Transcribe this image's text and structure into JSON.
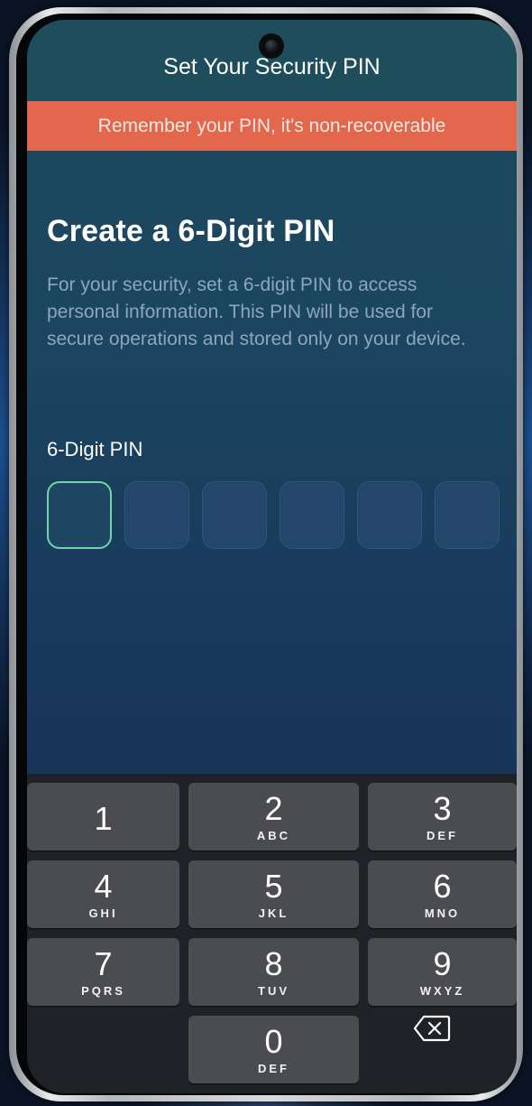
{
  "header": {
    "title": "Set Your Security PIN"
  },
  "banner": {
    "text": "Remember your PIN, it's non-recoverable",
    "color": "#e2674d"
  },
  "main": {
    "heading": "Create a 6-Digit PIN",
    "description": "For your security, set a 6-digit PIN to access personal information. This PIN will be used for secure operations and stored only on your device.",
    "pin_label": "6-Digit PIN",
    "pin_length": 6,
    "pin_entered": 0,
    "active_color": "#6fd4ac"
  },
  "keypad": {
    "keys": [
      {
        "digit": "1",
        "letters": ""
      },
      {
        "digit": "2",
        "letters": "ABC"
      },
      {
        "digit": "3",
        "letters": "DEF"
      },
      {
        "digit": "4",
        "letters": "GHI"
      },
      {
        "digit": "5",
        "letters": "JKL"
      },
      {
        "digit": "6",
        "letters": "MNO"
      },
      {
        "digit": "7",
        "letters": "PQRS"
      },
      {
        "digit": "8",
        "letters": "TUV"
      },
      {
        "digit": "9",
        "letters": "WXYZ"
      },
      {
        "digit": "0",
        "letters": "DEF"
      }
    ],
    "backspace_icon": "backspace-icon"
  }
}
